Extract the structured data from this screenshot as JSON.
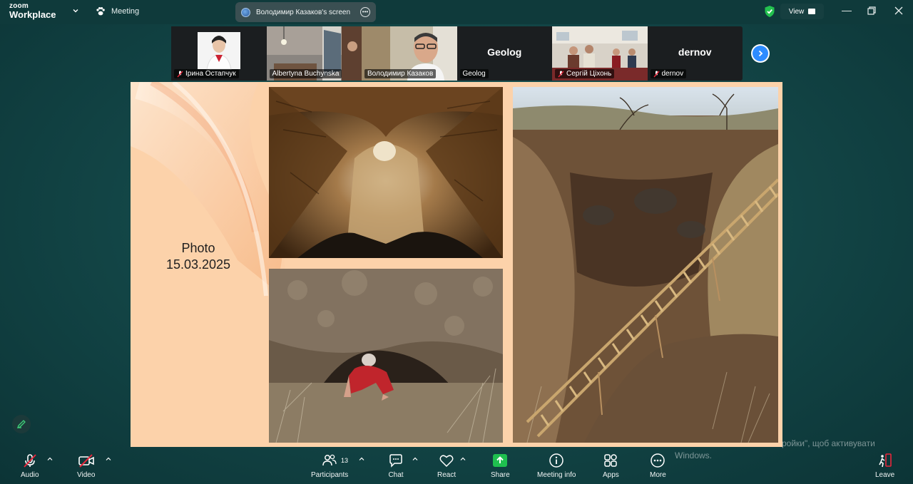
{
  "app": {
    "logo_line1": "zoom",
    "logo_line2": "Workplace"
  },
  "header": {
    "meeting_label": "Meeting",
    "screen_share_label": "Володимир Казаков's screen",
    "view_label": "View"
  },
  "participants": [
    {
      "name": "Ірина Остапчук",
      "muted": true
    },
    {
      "name": "Albertyna Buchynska",
      "muted": false
    },
    {
      "name": "Володимир Казаков",
      "muted": false,
      "active": true
    },
    {
      "name": "Geolog",
      "muted": false,
      "big_label": "Geolog"
    },
    {
      "name": "Сергій Ціхонь",
      "muted": true
    },
    {
      "name": "dernov",
      "muted": true,
      "big_label": "dernov"
    }
  ],
  "slide": {
    "caption_line1": "Photo",
    "caption_line2": "15.03.2025"
  },
  "watermark": {
    "line1": "ройки\", щоб активувати",
    "line2": "Windows."
  },
  "toolbar": {
    "audio_label": "Audio",
    "video_label": "Video",
    "participants_label": "Participants",
    "participants_count": "13",
    "chat_label": "Chat",
    "react_label": "React",
    "share_label": "Share",
    "meeting_info_label": "Meeting info",
    "apps_label": "Apps",
    "more_label": "More",
    "leave_label": "Leave"
  },
  "colors": {
    "accent_green": "#2ed158",
    "share_green": "#1fbf4f",
    "leave_red": "#e8263b",
    "next_blue": "#2d8cff"
  }
}
